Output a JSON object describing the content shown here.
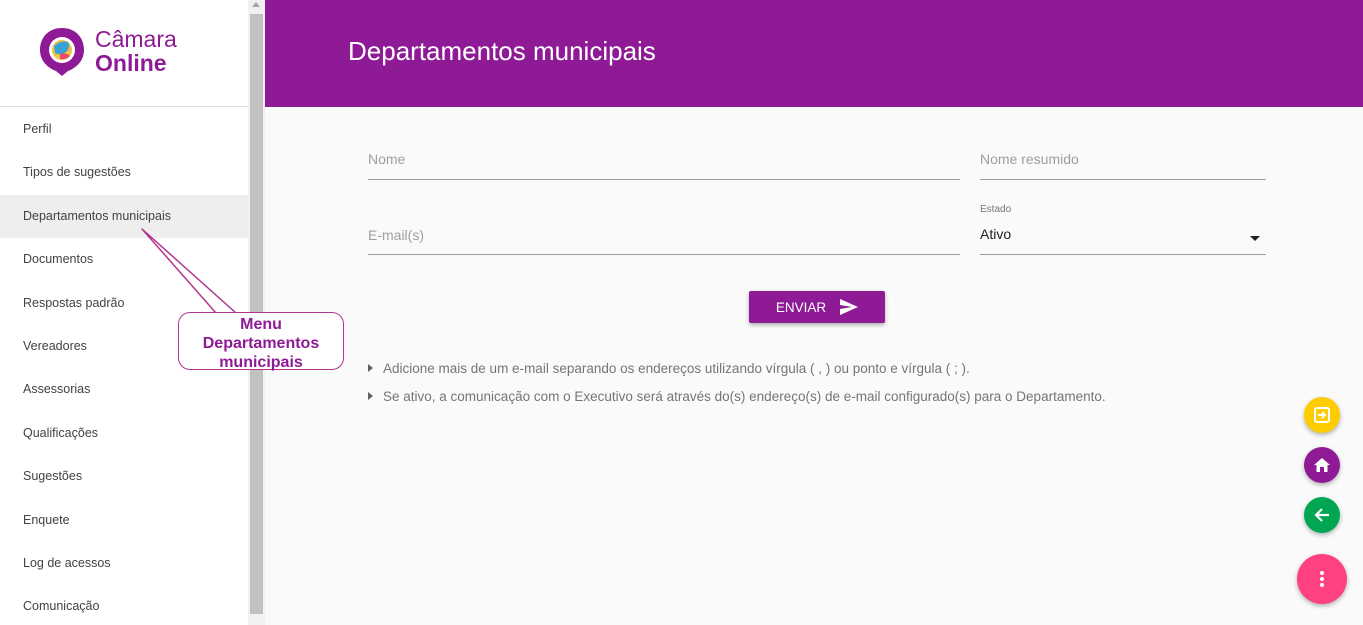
{
  "brand": {
    "line1": "Câmara",
    "line2": "Online"
  },
  "sidebar": {
    "items": [
      {
        "label": "Perfil"
      },
      {
        "label": "Tipos de sugestões"
      },
      {
        "label": "Departamentos municipais"
      },
      {
        "label": "Documentos"
      },
      {
        "label": "Respostas padrão"
      },
      {
        "label": "Vereadores"
      },
      {
        "label": "Assessorias"
      },
      {
        "label": "Qualificações"
      },
      {
        "label": "Sugestões"
      },
      {
        "label": "Enquete"
      },
      {
        "label": "Log de acessos"
      },
      {
        "label": "Comunicação"
      }
    ],
    "active_index": 2
  },
  "header": {
    "title": "Departamentos municipais"
  },
  "form": {
    "nome": {
      "placeholder": "Nome",
      "value": ""
    },
    "nome_resumido": {
      "placeholder": "Nome resumido",
      "value": ""
    },
    "email": {
      "placeholder": "E-mail(s)",
      "value": ""
    },
    "estado": {
      "label": "Estado",
      "value": "Ativo"
    },
    "submit_label": "ENVIAR"
  },
  "notes": [
    "Adicione mais de um e-mail separando os endereços utilizando vírgula ( , ) ou ponto e vírgula ( ; ).",
    "Se ativo, a comunicação com o Executivo será através do(s) endereço(s) de e-mail configurado(s) para o Departamento."
  ],
  "callout": {
    "line1": "Menu",
    "line2": "Departamentos",
    "line3": "municipais"
  },
  "fabs": [
    {
      "icon": "exit-icon",
      "color": "#ffcc00"
    },
    {
      "icon": "home-icon",
      "color": "#8e1a95"
    },
    {
      "icon": "arrow-back-icon",
      "color": "#00a651"
    },
    {
      "icon": "more-vert-icon",
      "color": "#ff4081"
    }
  ],
  "colors": {
    "primary": "#8e1a95",
    "callout_border": "#b2358f"
  }
}
